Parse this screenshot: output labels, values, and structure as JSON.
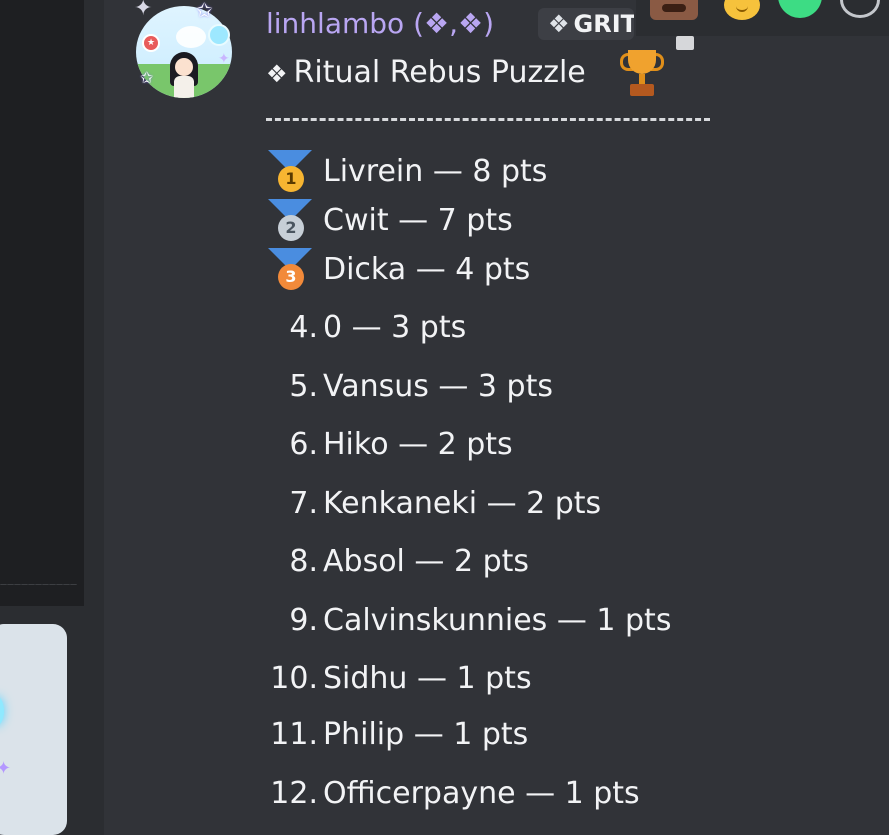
{
  "message": {
    "username": "linhlambo (❖,❖)",
    "role_icon": "❖",
    "role_tag": "GRIT",
    "title": "Ritual Rebus Puzzle",
    "title_icon": "❖",
    "trophy_icon": "trophy-icon"
  },
  "sidebar": {
    "server_separator_text": "———————————"
  },
  "reactions": [
    "face-sticker-icon",
    "slightly-smiling-face-icon",
    "green-heart-icon",
    "add-reaction-icon"
  ],
  "leaderboard": {
    "medalists": [
      {
        "medal": "1",
        "color": "#f7b531",
        "name": "Livrein — 8 pts"
      },
      {
        "medal": "2",
        "color": "#c7cfd7",
        "name": "Cwit — 7 pts"
      },
      {
        "medal": "3",
        "color": "#f28a3a",
        "name": "Dicka — 4 pts"
      }
    ],
    "ranked": [
      {
        "rank": "4.",
        "name": "0 — 3 pts"
      },
      {
        "rank": "5.",
        "name": "Vansus — 3 pts"
      },
      {
        "rank": "6.",
        "name": "Hiko — 2 pts"
      },
      {
        "rank": "7.",
        "name": "Kenkaneki — 2 pts"
      },
      {
        "rank": "8.",
        "name": "Absol — 2 pts"
      },
      {
        "rank": "9.",
        "name": "Calvinskunnies — 1 pts"
      },
      {
        "rank": "10.",
        "name": "Sidhu — 1 pts"
      },
      {
        "rank": "11.",
        "name": "Philip — 1 pts"
      },
      {
        "rank": "12.",
        "name": "Officerpayne — 1 pts"
      }
    ]
  },
  "colors": {
    "background": "#313338",
    "username": "#b9a6f2",
    "text": "#f2f3f5",
    "medal_ribbon": "#4a8de0"
  }
}
